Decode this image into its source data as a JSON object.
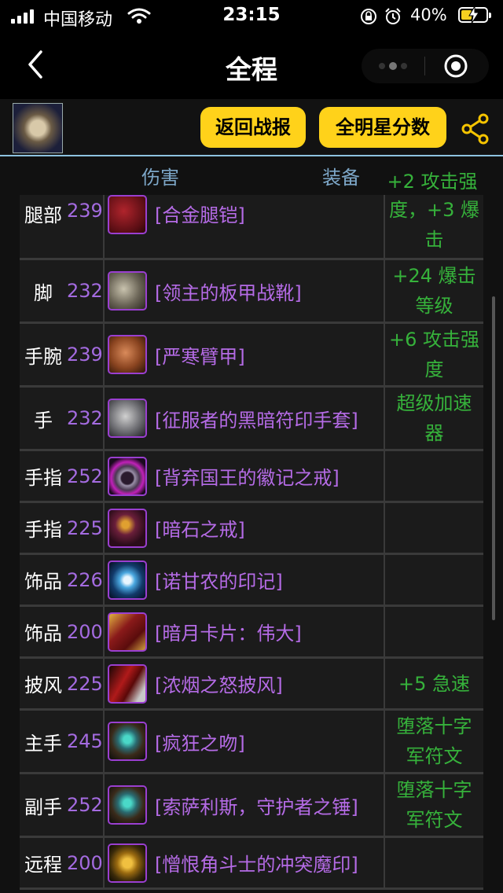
{
  "status_bar": {
    "carrier": "中国移动",
    "time": "23:15",
    "battery_percent": "40%"
  },
  "nav": {
    "title": "全程"
  },
  "header": {
    "return_button": "返回战报",
    "allstar_button": "全明星分数"
  },
  "table": {
    "col_damage": "伤害",
    "col_equip": "装备",
    "partial_top_enchant": "+2 攻击强",
    "rows": [
      {
        "slot": "腿部",
        "level": "239",
        "name": "[合金腿铠]",
        "enchant": "度，+3 爆击",
        "icon": "leg-armor-icon"
      },
      {
        "slot": "脚",
        "level": "232",
        "name": "[领主的板甲战靴]",
        "enchant": "+24 爆击等级",
        "icon": "plate-boots-icon"
      },
      {
        "slot": "手腕",
        "level": "239",
        "name": "[严寒臂甲]",
        "enchant": "+6 攻击强度",
        "icon": "bracer-icon"
      },
      {
        "slot": "手",
        "level": "232",
        "name": "[征服者的黑暗符印手套]",
        "enchant": "超级加速器",
        "icon": "gauntlet-icon"
      },
      {
        "slot": "手指",
        "level": "252",
        "name": "[背弃国王的徽记之戒]",
        "enchant": "",
        "icon": "ring-pink-icon"
      },
      {
        "slot": "手指",
        "level": "225",
        "name": "[暗石之戒]",
        "enchant": "",
        "icon": "ring-eye-icon"
      },
      {
        "slot": "饰品",
        "level": "226",
        "name": "[诺甘农的印记]",
        "enchant": "",
        "icon": "sigil-icon"
      },
      {
        "slot": "饰品",
        "level": "200",
        "name": "[暗月卡片：伟大]",
        "enchant": "",
        "icon": "darkmoon-card-icon"
      },
      {
        "slot": "披风",
        "level": "225",
        "name": "[浓烟之怒披风]",
        "enchant": "+5 急速",
        "icon": "cloak-icon"
      },
      {
        "slot": "主手",
        "level": "245",
        "name": "[疯狂之吻]",
        "enchant": "堕落十字军符文",
        "icon": "axe-main-hand-icon"
      },
      {
        "slot": "副手",
        "level": "252",
        "name": "[索萨利斯，守护者之锤]",
        "enchant": "堕落十字军符文",
        "icon": "mace-off-hand-icon"
      },
      {
        "slot": "远程",
        "level": "200",
        "name": "[憎恨角斗士的冲突魔印]",
        "enchant": "",
        "icon": "sigil-ranged-icon"
      }
    ]
  },
  "colors": {
    "button_yellow": "#ffd21a",
    "epic_purple": "#b56be6",
    "enchant_green": "#36b23b",
    "header_blue": "#8ec3e0"
  }
}
